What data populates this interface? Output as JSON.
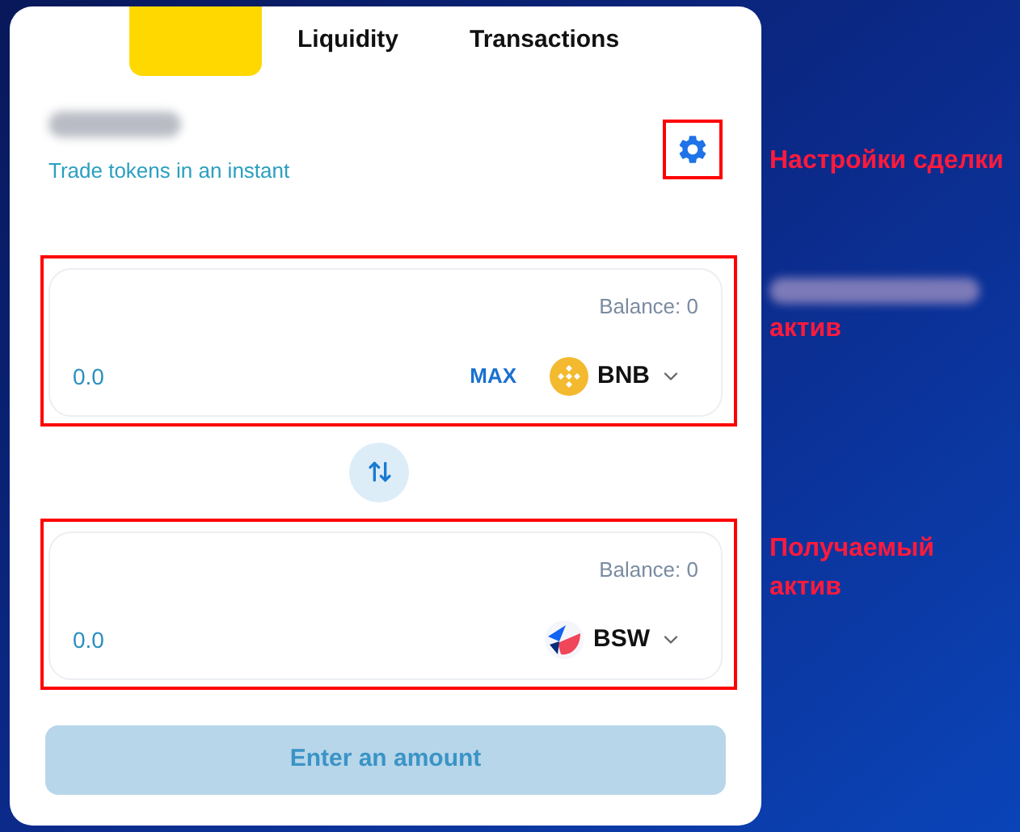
{
  "tabs": [
    {
      "selected": true
    },
    {
      "label": "Liquidity",
      "selected": false
    },
    {
      "label": "Transactions",
      "selected": false
    }
  ],
  "header": {
    "subtitle": "Trade tokens in an instant",
    "settings_highlighted": true
  },
  "inputs": [
    {
      "balance": "Balance: 0",
      "placeholder": "0.0",
      "max_label": "MAX",
      "token": {
        "symbol": "BNB",
        "kind": "bnb"
      },
      "highlighted": true
    },
    {
      "balance": "Balance: 0",
      "placeholder": "0.0",
      "token": {
        "symbol": "BSW",
        "kind": "bsw"
      },
      "highlighted": true
    }
  ],
  "submit": {
    "label": "Enter an amount",
    "disabled": true
  },
  "annotations": [
    {
      "text": "Настройки сделки",
      "blurred_prefix": false
    },
    {
      "text": "актив",
      "blurred_prefix": true
    },
    {
      "text": "Получаемый актив",
      "blurred_prefix": false
    }
  ]
}
